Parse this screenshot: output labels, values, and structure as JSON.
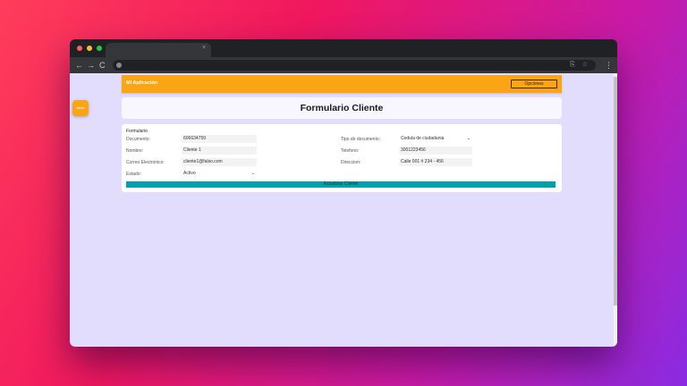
{
  "browser": {
    "tab_close": "×",
    "nav": {
      "back": "←",
      "forward": "→",
      "reload": "C"
    },
    "omnibox_icons": "⎘ ☆",
    "menu": "⋮"
  },
  "app": {
    "brand": "Mi Aplicación",
    "options_label": "Opciones",
    "side_button_label": "Atrás",
    "page_title": "Formulario Cliente",
    "accent_color": "#fba515",
    "button_color": "#00a0ad",
    "background_color": "#e2dcfd"
  },
  "form": {
    "heading": "Formulario",
    "documento": {
      "label": "Documento:",
      "value": "606634759"
    },
    "tipo_documento": {
      "label": "Tipo de documento:",
      "value": "Cedula de ciudadania"
    },
    "nombre": {
      "label": "Nombre:",
      "value": "Cliente 1"
    },
    "telefono": {
      "label": "Telefono:",
      "value": "3001223456"
    },
    "correo": {
      "label": "Correo Electronico:",
      "value": "cliente1@falso.com"
    },
    "direccion": {
      "label": "Direccion:",
      "value": "Calle 001 # 234 - 456"
    },
    "estado": {
      "label": "Estado:",
      "value": "Activo"
    },
    "update_label": "Actualizar Cliente"
  }
}
